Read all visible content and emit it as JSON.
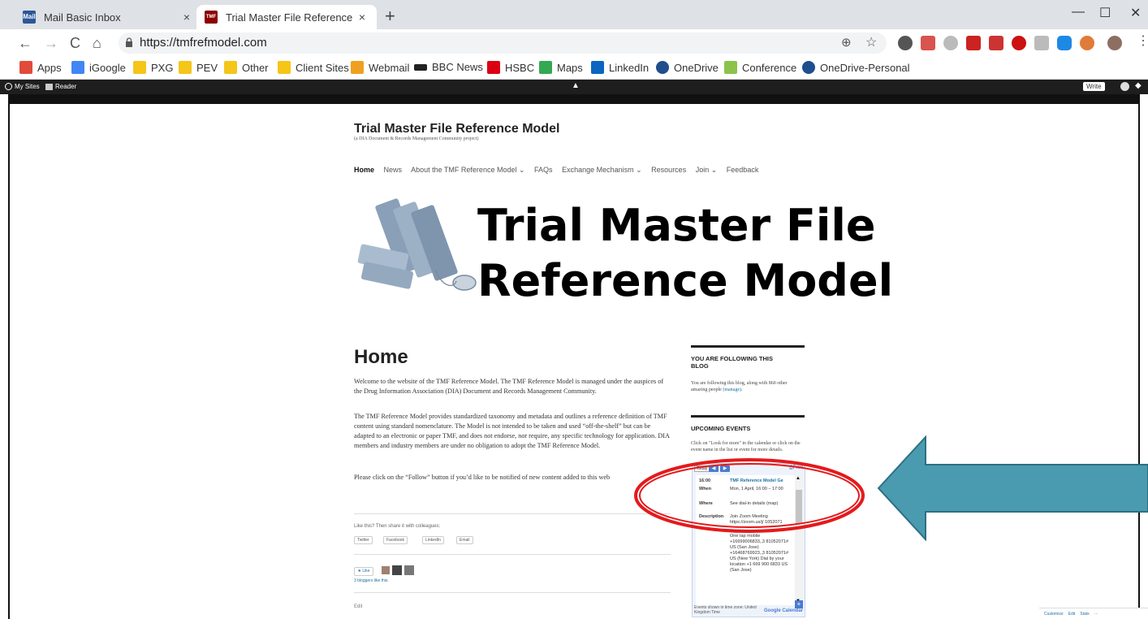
{
  "browser": {
    "tabs": [
      {
        "title": "Mail Basic Inbox",
        "close": "×",
        "favicon_color": "#2b5797",
        "favicon_text": "Mail"
      },
      {
        "title": "Trial Master File Reference Mode",
        "close": "×",
        "favicon_color": "#8b0000",
        "favicon_text": "TMF"
      }
    ],
    "new_tab": "+",
    "window_controls": {
      "minimize": "—",
      "maximize": "☐",
      "close": "✕"
    },
    "nav": {
      "back": "←",
      "forward": "→",
      "reload": "C",
      "home": "⌂"
    },
    "url": "https://tmfrefmodel.com",
    "omnibox_icons": {
      "zoom": "⊕",
      "star": "☆"
    },
    "extension_colors": [
      "#555555",
      "#d9534f",
      "#bbbbbb",
      "#cc2222",
      "#cc3333",
      "#cc1111",
      "#bbbbbb",
      "#1e88e5",
      "#e07b39",
      "#8d6e63"
    ],
    "bookmarks": [
      {
        "label": "Apps",
        "color": "#e04b3c"
      },
      {
        "label": "iGoogle",
        "color": "#4285f4"
      },
      {
        "label": "PXG",
        "color": "#f5c518"
      },
      {
        "label": "PEV",
        "color": "#f5c518"
      },
      {
        "label": "Other",
        "color": "#f5c518"
      },
      {
        "label": "Client Sites",
        "color": "#f5c518"
      },
      {
        "label": "Webmail",
        "color": "#f0a020"
      },
      {
        "label": "BBC News",
        "color": "#222222"
      },
      {
        "label": "HSBC",
        "color": "#db0011"
      },
      {
        "label": "Maps",
        "color": "#34a853"
      },
      {
        "label": "LinkedIn",
        "color": "#0a66c2"
      },
      {
        "label": "OneDrive",
        "color": "#1e4e8c"
      },
      {
        "label": "Conference",
        "color": "#8bc34a"
      },
      {
        "label": "OneDrive-Personal",
        "color": "#1e4e8c"
      }
    ]
  },
  "wp_admin_bar": {
    "my_sites": "My Sites",
    "reader": "Reader",
    "write": "Write"
  },
  "site": {
    "title": "Trial Master File Reference Model",
    "description": "(a DIA Document & Records Management Community project)",
    "nav": [
      "Home",
      "News",
      "About the TMF Reference Model ⌄",
      "FAQs",
      "Exchange Mechanism ⌄",
      "Resources",
      "Join ⌄",
      "Feedback"
    ],
    "header_line1": "Trial Master File",
    "header_line2": "Reference Model"
  },
  "main": {
    "heading": "Home",
    "paragraphs": [
      "Welcome to the website of the TMF Reference Model. The TMF Reference Model is managed under the auspices of the Drug Information Association (DIA) Document and Records Management Community.",
      "The TMF Reference Model provides standardized taxonomy and metadata and outlines a reference definition of TMF content using standard nomenclature. The Model is not intended to be taken and used “off-the-shelf” but can be adapted to an electronic or paper TMF, and does not endorse, nor require, any specific technology for application. DIA members and industry members are under no obligation to adopt the TMF Reference Model.",
      "Please click on the “Follow” button if you’d like to be notified of new content added to this web"
    ],
    "share_label": "Like this? Then share it with colleagues:",
    "share_buttons": [
      "Twitter",
      "Facebook",
      "LinkedIn",
      "Email"
    ],
    "like_button": "★ Like",
    "bloggers_like": "3 bloggers like this.",
    "edit": "Edit"
  },
  "sidebar": {
    "following_heading": "YOU ARE FOLLOWING THIS BLOG",
    "following_text": "You are following this blog, along with 860 other amazing people",
    "manage_link": "(manage).",
    "events_heading": "UPCOMING EVENTS",
    "events_intro": "Click on \"Look for more\" in the calendar or click on the event name in the list or event for more details.",
    "calendar": {
      "today": "Today",
      "prev": "◀",
      "next": "▶",
      "print": "Print",
      "time": "16:00",
      "event_title": "TMF Reference Model Ge",
      "rows": [
        {
          "key": "When",
          "value": "Mon, 1 April, 16:00 – 17:00"
        },
        {
          "key": "Where",
          "value": "See dial-in details (map)"
        },
        {
          "key": "Description",
          "value": "Join Zoom Meeting https://zoom.us/j/ 1052071"
        }
      ],
      "details": "One tap mobile +16699006833,,3 81052071# US (San Jose) +16468769923,,3 81052071# US (New York) Dial by your location +1 669 900 6833 US (San Jose)",
      "footer": "Events shown in time zone: United Kingdom Time",
      "logo": "Google Calendar",
      "plus": "+"
    }
  },
  "footer_bar": [
    "Customize",
    "Edit",
    "Stats",
    "···"
  ],
  "annotation": {
    "circle_color": "#e41a1c",
    "arrow_color": "#4a9bb0"
  }
}
